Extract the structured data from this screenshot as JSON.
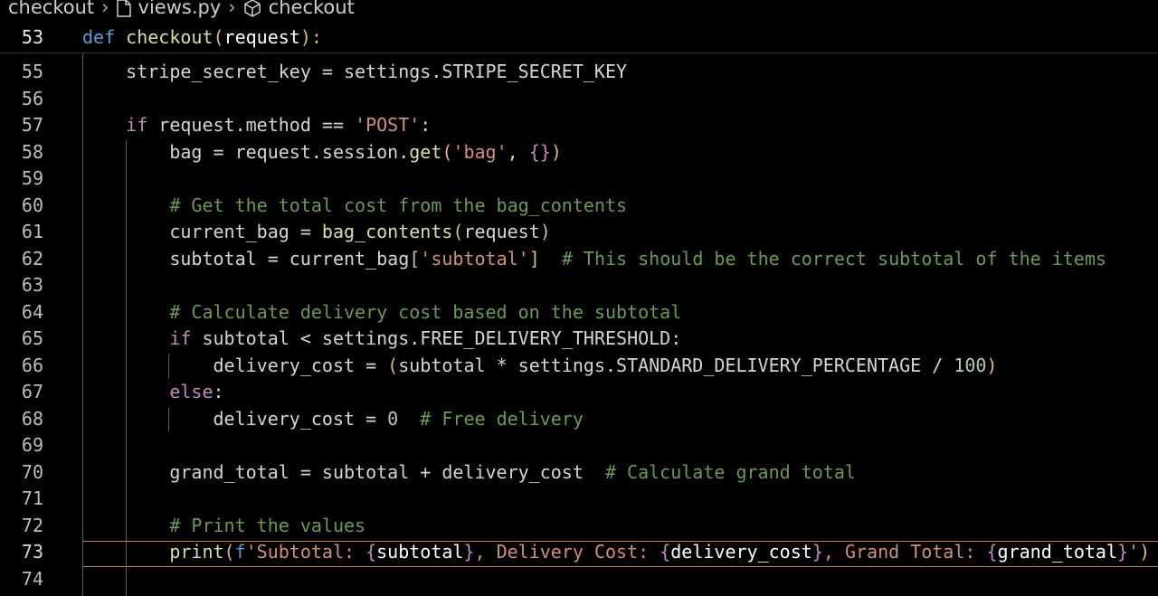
{
  "breadcrumb": {
    "folder": "checkout",
    "file": "views.py",
    "symbol": "checkout",
    "icons": [
      "chevron-right-icon",
      "file-icon",
      "cube-icon"
    ]
  },
  "sticky": {
    "line_number": "53",
    "kw": "def",
    "name": "checkout",
    "open": "(",
    "param": "request",
    "close": "):"
  },
  "lines": [
    {
      "n": "55",
      "text": "    stripe_secret_key = settings.STRIPE_SECRET_KEY"
    },
    {
      "n": "56",
      "text": ""
    },
    {
      "n": "57",
      "text": "    if request.method == 'POST':"
    },
    {
      "n": "58",
      "text": "        bag = request.session.get('bag', {})"
    },
    {
      "n": "59",
      "text": ""
    },
    {
      "n": "60",
      "text": "        # Get the total cost from the bag_contents"
    },
    {
      "n": "61",
      "text": "        current_bag = bag_contents(request)"
    },
    {
      "n": "62",
      "text": "        subtotal = current_bag['subtotal']  # This should be the correct subtotal of the items"
    },
    {
      "n": "63",
      "text": ""
    },
    {
      "n": "64",
      "text": "        # Calculate delivery cost based on the subtotal"
    },
    {
      "n": "65",
      "text": "        if subtotal < settings.FREE_DELIVERY_THRESHOLD:"
    },
    {
      "n": "66",
      "text": "            delivery_cost = (subtotal * settings.STANDARD_DELIVERY_PERCENTAGE / 100)"
    },
    {
      "n": "67",
      "text": "        else:"
    },
    {
      "n": "68",
      "text": "            delivery_cost = 0  # Free delivery"
    },
    {
      "n": "69",
      "text": ""
    },
    {
      "n": "70",
      "text": "        grand_total = subtotal + delivery_cost  # Calculate grand total"
    },
    {
      "n": "71",
      "text": ""
    },
    {
      "n": "72",
      "text": "        # Print the values"
    },
    {
      "n": "73",
      "text": "        print(f'Subtotal: {subtotal}, Delivery Cost: {delivery_cost}, Grand Total: {grand_total}')"
    },
    {
      "n": "74",
      "text": ""
    }
  ],
  "current_line": "73",
  "colors": {
    "background": "#000000",
    "keyword": "#569cd6",
    "control": "#c586c0",
    "string": "#ce9178",
    "comment": "#6a9955",
    "number": "#b5cea8",
    "function": "#dcdcaa",
    "current_line_border": "#c9843c"
  }
}
